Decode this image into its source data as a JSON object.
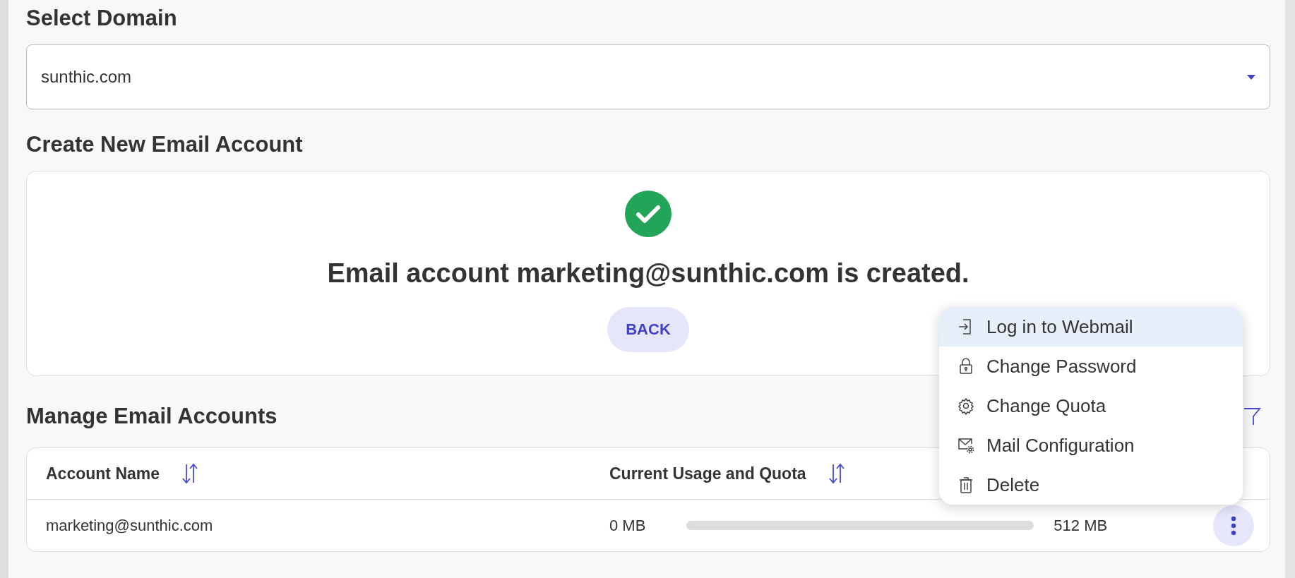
{
  "domain_section": {
    "title": "Select Domain",
    "select": {
      "value": "sunthic.com"
    }
  },
  "create_section": {
    "title": "Create New Email Account",
    "message": "Email account marketing@sunthic.com is created.",
    "back_button": "BACK"
  },
  "manage_section": {
    "title": "Manage Email Accounts",
    "table": {
      "columns": [
        "Account Name",
        "Current Usage and Quota"
      ],
      "rows": [
        {
          "account": "marketing@sunthic.com",
          "usage": "0 MB",
          "level": 0,
          "quota": "512 MB"
        }
      ]
    }
  },
  "action_menu": {
    "items": [
      {
        "label": "Log in to Webmail",
        "selected": true
      },
      {
        "label": "Change Password",
        "selected": false
      },
      {
        "label": "Change Quota",
        "selected": false
      },
      {
        "label": "Mail Configuration",
        "selected": false
      },
      {
        "label": "Delete",
        "selected": false
      }
    ]
  }
}
